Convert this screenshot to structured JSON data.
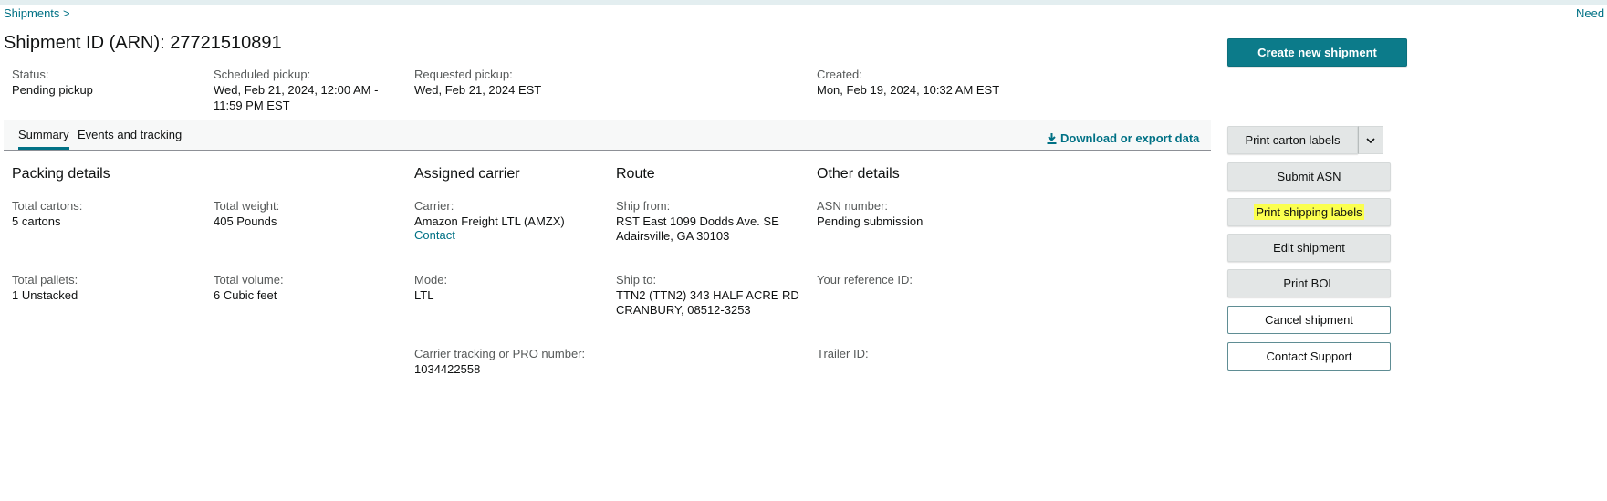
{
  "breadcrumb": {
    "shipments": "Shipments >"
  },
  "help": {
    "need": "Need"
  },
  "page": {
    "title": "Shipment ID (ARN): 27721510891"
  },
  "summary": {
    "status_label": "Status:",
    "status_value": "Pending pickup",
    "scheduled_label": "Scheduled pickup:",
    "scheduled_value": "Wed, Feb 21, 2024, 12:00 AM - 11:59 PM EST",
    "requested_label": "Requested pickup:",
    "requested_value": "Wed, Feb 21, 2024 EST",
    "created_label": "Created:",
    "created_value": "Mon, Feb 19, 2024, 10:32 AM EST"
  },
  "tabs": {
    "summary": "Summary",
    "events": "Events and tracking",
    "download": "Download or export data"
  },
  "packing": {
    "heading": "Packing details",
    "cartons_label": "Total cartons:",
    "cartons_value": "5 cartons",
    "weight_label": "Total weight:",
    "weight_value": "405 Pounds",
    "pallets_label": "Total pallets:",
    "pallets_value": "1 Unstacked",
    "volume_label": "Total volume:",
    "volume_value": "6 Cubic feet"
  },
  "carrier": {
    "heading": "Assigned carrier",
    "carrier_label": "Carrier:",
    "carrier_value": "Amazon Freight LTL (AMZX)",
    "contact_link": "Contact",
    "mode_label": "Mode:",
    "mode_value": "LTL",
    "tracking_label": "Carrier tracking or PRO number:",
    "tracking_value": "1034422558"
  },
  "route": {
    "heading": "Route",
    "from_label": "Ship from:",
    "from_line1": "RST East 1099 Dodds Ave. SE",
    "from_line2": "Adairsville, GA 30103",
    "to_label": "Ship to:",
    "to_line1": "TTN2 (TTN2) 343 HALF ACRE RD",
    "to_line2": "CRANBURY, 08512-3253"
  },
  "other": {
    "heading": "Other details",
    "asn_label": "ASN number:",
    "asn_value": "Pending submission",
    "ref_label": "Your reference ID:",
    "trailer_label": "Trailer ID:"
  },
  "actions": {
    "create": "Create new shipment",
    "print_carton": "Print carton labels",
    "submit_asn": "Submit ASN",
    "print_shipping": "Print shipping labels",
    "edit": "Edit shipment",
    "print_bol": "Print BOL",
    "cancel": "Cancel shipment",
    "contact_support": "Contact Support"
  },
  "icons": {
    "download": "download-icon",
    "dropdown": "chevron-down-icon"
  },
  "colors": {
    "accent": "#007185",
    "primary_button": "#0c7b8a",
    "highlight": "#fbff4e"
  }
}
